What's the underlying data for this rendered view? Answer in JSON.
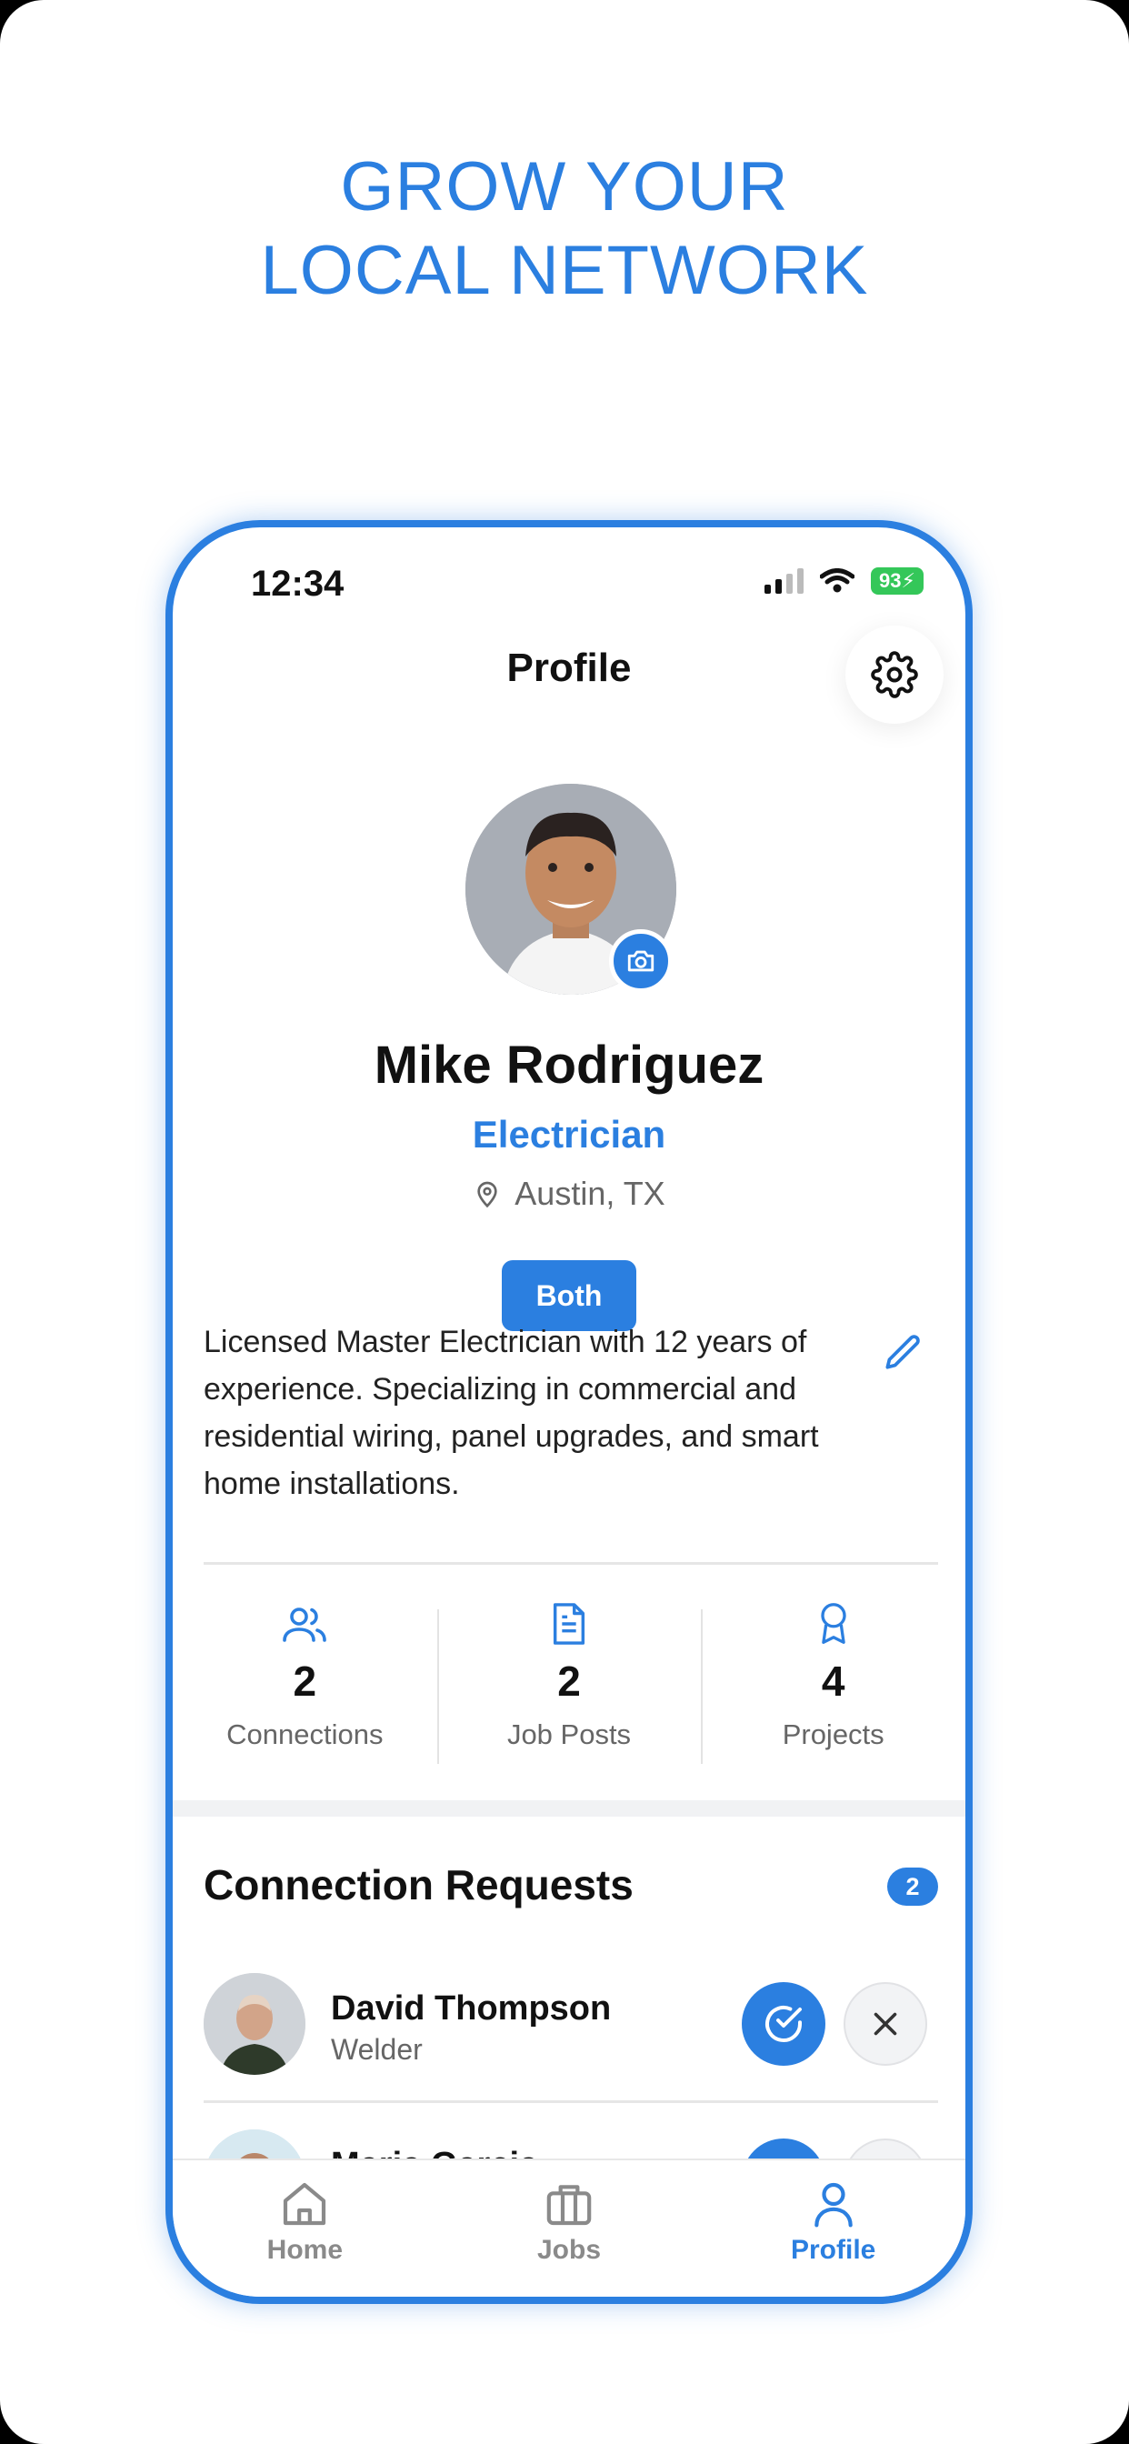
{
  "headline": {
    "line1": "GROW YOUR",
    "line2": "LOCAL NETWORK"
  },
  "status_bar": {
    "time": "12:34",
    "battery": "93"
  },
  "header": {
    "title": "Profile"
  },
  "profile": {
    "name": "Mike Rodriguez",
    "role": "Electrician",
    "location": "Austin, TX",
    "type_badge": "Both",
    "bio": "Licensed Master Electrician with 12 years of experience. Specializing in commercial and residential wiring, panel upgrades, and smart home installations."
  },
  "stats": [
    {
      "icon": "users-icon",
      "value": "2",
      "label": "Connections"
    },
    {
      "icon": "document-icon",
      "value": "2",
      "label": "Job Posts"
    },
    {
      "icon": "award-icon",
      "value": "4",
      "label": "Projects"
    }
  ],
  "connection_requests": {
    "title": "Connection Requests",
    "count": "2",
    "items": [
      {
        "name": "David Thompson",
        "role": "Welder"
      },
      {
        "name": "Maria Garcia",
        "role": ""
      }
    ]
  },
  "tabbar": {
    "items": [
      {
        "label": "Home",
        "icon": "home-icon",
        "active": false
      },
      {
        "label": "Jobs",
        "icon": "briefcase-icon",
        "active": false
      },
      {
        "label": "Profile",
        "icon": "person-icon",
        "active": true
      }
    ]
  },
  "colors": {
    "accent": "#2b7fe0",
    "battery": "#34c759"
  }
}
